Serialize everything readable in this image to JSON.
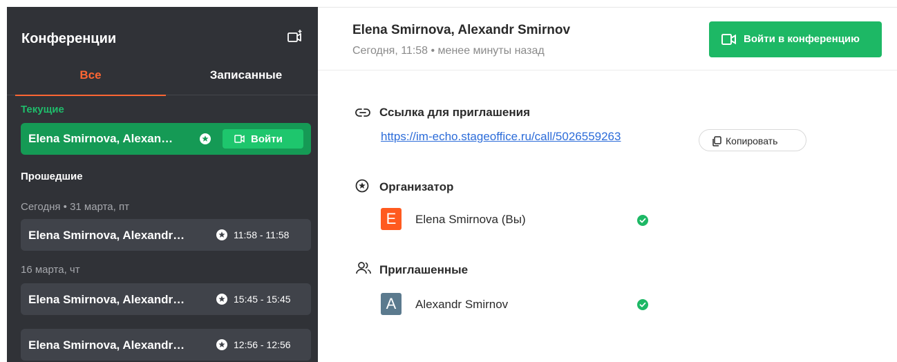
{
  "sidebar": {
    "title": "Конференции",
    "new_conference_icon": "video-plus-icon",
    "tabs": [
      {
        "label": "Все",
        "active": true
      },
      {
        "label": "Записанные",
        "active": false
      }
    ],
    "current_section": "Текущие",
    "current": {
      "name": "Elena Smirnova, Alexan…",
      "join_label": "Войти"
    },
    "past_section": "Прошедшие",
    "groups": [
      {
        "date": "Сегодня • 31 марта, пт",
        "items": [
          {
            "name": "Elena Smirnova, Alexandr…",
            "time": "11:58 - 11:58"
          }
        ]
      },
      {
        "date": "16 марта, чт",
        "items": [
          {
            "name": "Elena Smirnova, Alexandr…",
            "time": "15:45 - 15:45"
          },
          {
            "name": "Elena Smirnova, Alexandr…",
            "time": "12:56 - 12:56"
          }
        ]
      }
    ]
  },
  "main": {
    "title": "Elena Smirnova, Alexandr Smirnov",
    "subtitle": "Сегодня, 11:58 • менее минуты назад",
    "join_button": "Войти в конференцию",
    "invite": {
      "title": "Ссылка для приглашения",
      "link": "https://im-echo.stageoffice.ru/call/5026559263",
      "copy_label": "Копировать"
    },
    "organizer": {
      "title": "Организатор",
      "initial": "E",
      "name": "Elena Smirnova (Вы)"
    },
    "invited": {
      "title": "Приглашенные",
      "initial": "A",
      "name": "Alexandr Smirnov"
    }
  },
  "colors": {
    "accent_orange": "#ff6633",
    "green": "#1db865",
    "sidebar_bg": "#303237",
    "card_bg": "#40434a",
    "link": "#2c6cd9",
    "avatar_orange": "#ff5a1f",
    "avatar_slate": "#5b7a8e"
  }
}
